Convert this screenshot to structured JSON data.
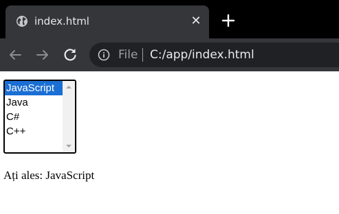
{
  "browser": {
    "tab": {
      "title": "index.html",
      "favicon": "globe-icon",
      "close_glyph": "✕"
    },
    "new_tab_icon": "plus-icon",
    "toolbar": {
      "back_icon": "arrow-left-icon",
      "forward_icon": "arrow-right-icon",
      "reload_icon": "reload-icon",
      "info_icon": "info-icon",
      "scheme_label": "File",
      "url": "C:/app/index.html"
    },
    "colors": {
      "tabstrip_bg": "#000000",
      "toolbar_bg": "#35363a",
      "omnibox_bg": "#202124",
      "text_primary": "#e8eaed",
      "text_secondary": "#9aa0a6"
    }
  },
  "page": {
    "listbox": {
      "options": [
        "JavaScript",
        "Java",
        "C#",
        "C++"
      ],
      "selected_index": 0,
      "selected_color": "#1a6fd4"
    },
    "result": {
      "prefix": "Ați ales: ",
      "value": "JavaScript"
    }
  }
}
